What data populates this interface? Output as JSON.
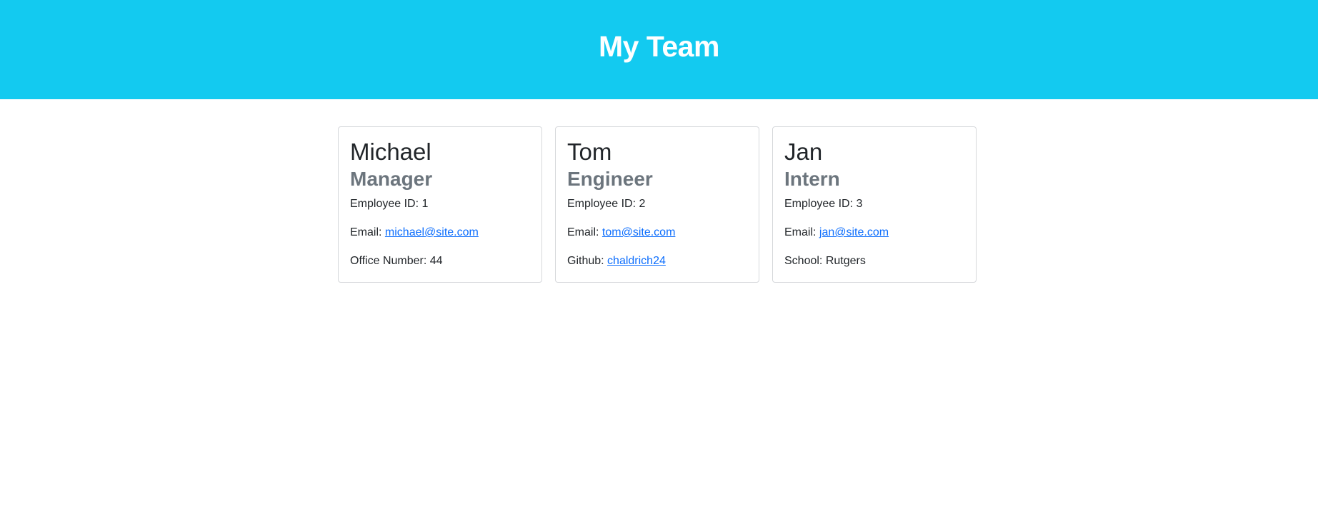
{
  "header": {
    "title": "My Team"
  },
  "labels": {
    "employee_id": "Employee ID:",
    "email": "Email:",
    "office": "Office Number:",
    "github": "Github:",
    "school": "School:"
  },
  "cards": [
    {
      "name": "Michael",
      "role": "Manager",
      "id": "1",
      "email": "michael@site.com",
      "extra": "44"
    },
    {
      "name": "Tom",
      "role": "Engineer",
      "id": "2",
      "email": "tom@site.com",
      "extra": "chaldrich24"
    },
    {
      "name": "Jan",
      "role": "Intern",
      "id": "3",
      "email": "jan@site.com",
      "extra": "Rutgers"
    }
  ],
  "colors": {
    "banner": "#13caf0",
    "role_text": "#6c757d",
    "link": "#0d6efd"
  }
}
